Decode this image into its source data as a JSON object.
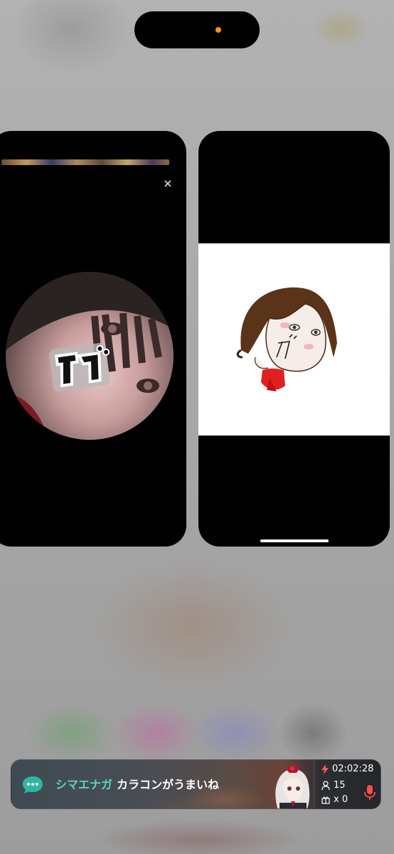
{
  "overlay_close_glyph": "×",
  "live_banner": {
    "comment_user": "シマエナガ",
    "comment_text": "カラコンがうまいね",
    "elapsed_time": "02:02:28",
    "viewer_count": "15",
    "gift_count": "x 0"
  },
  "colors": {
    "status_dot": "#ff9500",
    "username": "#5fd3c3",
    "timer_bolt": "#ff5a4e",
    "mic": "#ff4d4d",
    "chat_bubble": "#2fb6a0"
  }
}
